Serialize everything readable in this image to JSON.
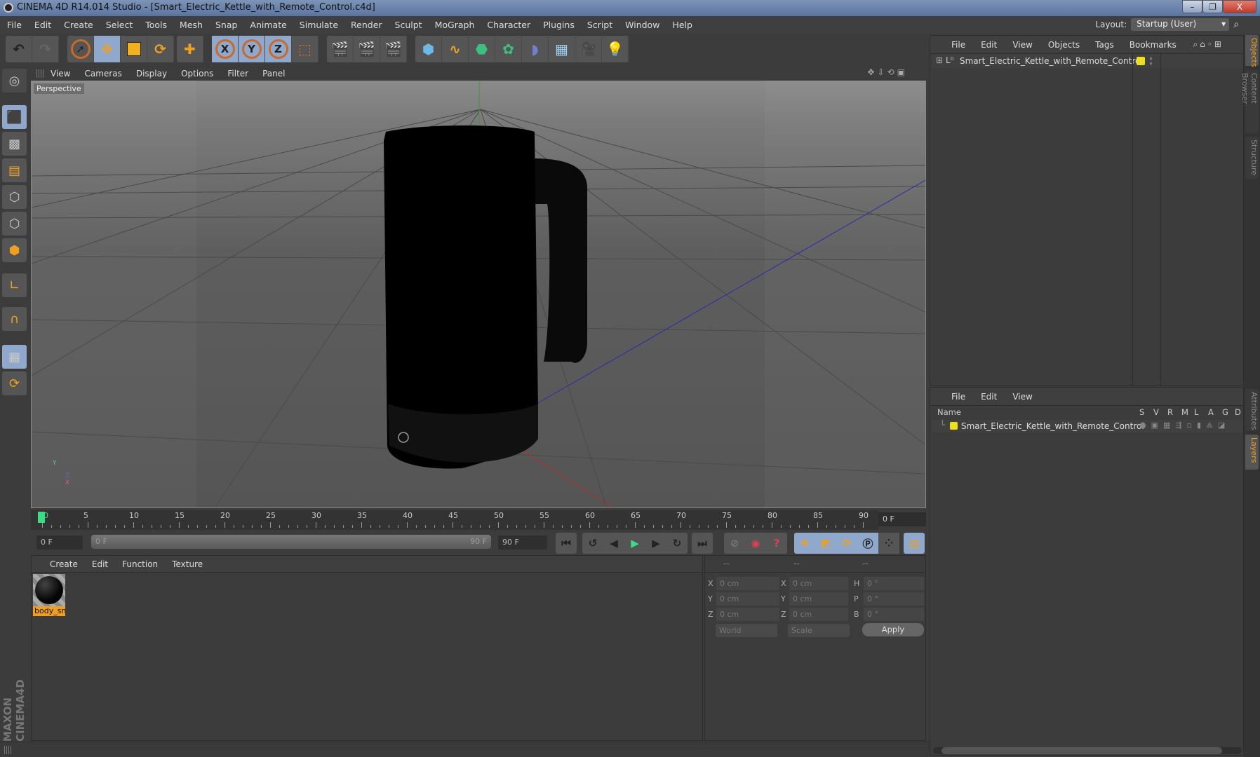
{
  "window": {
    "title": "CINEMA 4D R14.014 Studio - [Smart_Electric_Kettle_with_Remote_Control.c4d]",
    "minimize": "–",
    "restore": "❐",
    "close": "X"
  },
  "menu": [
    "File",
    "Edit",
    "Create",
    "Select",
    "Tools",
    "Mesh",
    "Snap",
    "Animate",
    "Simulate",
    "Render",
    "Sculpt",
    "MoGraph",
    "Character",
    "Plugins",
    "Script",
    "Window",
    "Help"
  ],
  "layout": {
    "label": "Layout:",
    "value": "Startup (User)"
  },
  "toolbar": {
    "axis_x": "X",
    "axis_y": "Y",
    "axis_z": "Z"
  },
  "viewport": {
    "menu": [
      "View",
      "Cameras",
      "Display",
      "Options",
      "Filter",
      "Panel"
    ],
    "label": "Perspective",
    "axes": {
      "y": "Y",
      "z": "Z",
      "x": "X"
    }
  },
  "timeline": {
    "ticks": [
      "0",
      "5",
      "10",
      "15",
      "20",
      "25",
      "30",
      "35",
      "40",
      "45",
      "50",
      "55",
      "60",
      "65",
      "70",
      "75",
      "80",
      "85",
      "90"
    ],
    "current_frame": "0 F",
    "start": "0 F",
    "slider_start": "0 F",
    "slider_end": "90 F",
    "end": "90 F"
  },
  "materials": {
    "menu": [
      "Create",
      "Edit",
      "Function",
      "Texture"
    ],
    "items": [
      {
        "name": "body_sn"
      }
    ]
  },
  "coordinates": {
    "headers": [
      "--",
      "--",
      "--"
    ],
    "rows": [
      {
        "l1": "X",
        "v1": "0 cm",
        "l2": "X",
        "v2": "0 cm",
        "l3": "H",
        "v3": "0 °"
      },
      {
        "l1": "Y",
        "v1": "0 cm",
        "l2": "Y",
        "v2": "0 cm",
        "l3": "P",
        "v3": "0 °"
      },
      {
        "l1": "Z",
        "v1": "0 cm",
        "l2": "Z",
        "v2": "0 cm",
        "l3": "B",
        "v3": "0 °"
      }
    ],
    "mode": "World",
    "transform": "Scale",
    "apply": "Apply"
  },
  "object_manager": {
    "menu": [
      "File",
      "Edit",
      "View",
      "Objects",
      "Tags",
      "Bookmarks"
    ],
    "objects": [
      {
        "name": "Smart_Electric_Kettle_with_Remote_Control"
      }
    ]
  },
  "layers": {
    "menu": [
      "File",
      "Edit",
      "View"
    ],
    "columns": [
      "Name",
      "S",
      "V",
      "R",
      "M",
      "L",
      "A",
      "G",
      "D"
    ],
    "rows": [
      {
        "name": "Smart_Electric_Kettle_with_Remote_Control"
      }
    ]
  },
  "side_tabs": [
    "Objects",
    "Content Browser",
    "Structure",
    "Attributes",
    "Layers"
  ],
  "brand": "MAXON CINEMA 4D",
  "colors": {
    "accent": "#f0a020",
    "layer_yellow": "#e8e020",
    "timeline_green": "#3ddc84"
  }
}
